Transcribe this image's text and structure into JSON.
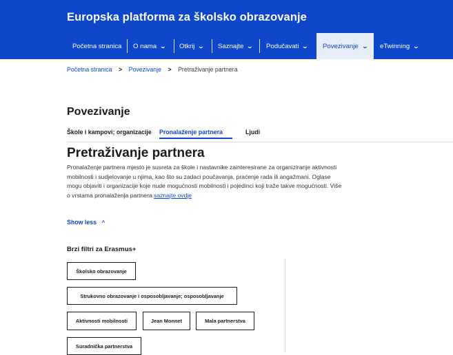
{
  "site": {
    "title": "Europska platforma za školsko obrazovanje"
  },
  "nav": {
    "items": [
      {
        "label": "Početna stranica",
        "dropdown": false
      },
      {
        "label": "O nama",
        "dropdown": true
      },
      {
        "label": "Otkrij",
        "dropdown": true
      },
      {
        "label": "Saznajte",
        "dropdown": true
      },
      {
        "label": "Podučavati",
        "dropdown": true
      },
      {
        "label": "Povezivanje",
        "dropdown": true,
        "active": true
      },
      {
        "label": "eTwinning",
        "dropdown": true
      }
    ],
    "chevron": "⌄"
  },
  "breadcrumb": {
    "items": [
      "Početna stranica",
      "Povezivanje",
      "Pretraživanje partnera"
    ],
    "separator": ">"
  },
  "page": {
    "title": "Povezivanje"
  },
  "tabs": [
    {
      "label": "Škole i kampovi; organizacije",
      "active": false
    },
    {
      "label": "Pronalaženje partnera",
      "active": true
    },
    {
      "label": "Ljudi",
      "active": false
    }
  ],
  "section": {
    "title": "Pretraživanje partnera",
    "description": "Pronalaženje partnera mjesto je susreta za škole i nastavnike zainteresirane za organiziranje aktivnosti mobilnosti i sudjelovanje u njima, kao što su zadaci poučavanja, praćenje rada ili angažmani. Oglase mogu objaviti i organizacije koje nude mogućnosti mobilnosti i pojedinci koji traže takve mogućnosti. Više o vrstama pronalaženja partnera ",
    "link_text": "saznajte ovdje",
    "show_less": "Show less",
    "show_less_icon": "^"
  },
  "filters": {
    "title": "Brzi filtri za Erasmus+",
    "chips": [
      "Školsko obrazovanje",
      "Strukovno obrazovanje i osposobljavanje; osposobljavanje",
      "Aktivnosti mobilnosti",
      "Jean Monnet",
      "Mala partnerstva",
      "Suradnička partnerstva"
    ]
  },
  "colors": {
    "brand": "#0e47cb",
    "active_tab_bg": "#e6edf7",
    "text": "#1a1a1a"
  }
}
